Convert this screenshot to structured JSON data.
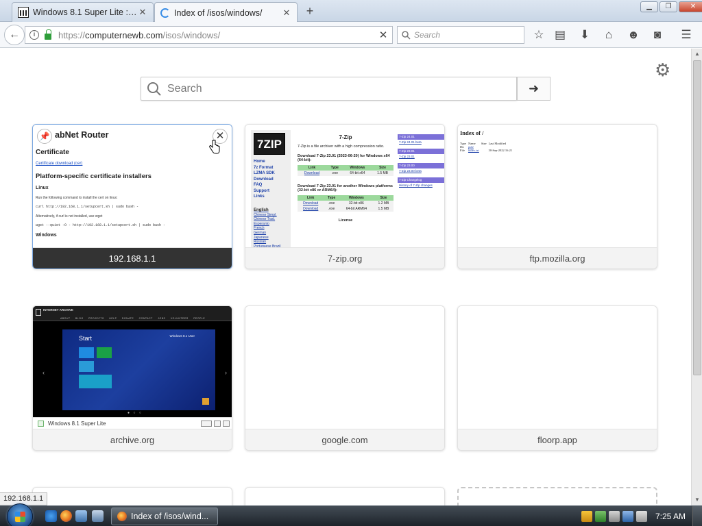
{
  "browser": {
    "tabs": [
      {
        "title": "Windows 8.1 Super Lite : c...",
        "favicon": "archive-icon",
        "active": false
      },
      {
        "title": "Index of /isos/windows/",
        "favicon": "loading-spinner-icon",
        "active": true
      }
    ],
    "url": {
      "host": "computernewb.com",
      "path": "/isos/windows/",
      "scheme": "https://"
    },
    "search_placeholder": "Search"
  },
  "newtab": {
    "search_placeholder": "Search",
    "tiles": [
      {
        "label": "192.168.1.1",
        "hovered": true
      },
      {
        "label": "7-zip.org"
      },
      {
        "label": "ftp.mozilla.org"
      },
      {
        "label": "archive.org"
      },
      {
        "label": "google.com"
      },
      {
        "label": "floorp.app"
      }
    ]
  },
  "router_thumb": {
    "title": "GL.iNet Router",
    "title_visible": "abNet Router",
    "section": "Certificate",
    "link": "Certificate download (cer)",
    "heading": "Platform-specific certificate installers",
    "linux": "Linux",
    "p1": "Run the following command to install the cert on linux:",
    "cmd1": "curl http://192.168.1.1/setupcert.sh | sudo bash -",
    "p2": "Alternatively, if curl is not installed, use wget",
    "cmd2": "wget --quiet -O - http://192.168.1.1/setupcert.sh | sudo bash -",
    "windows": "Windows"
  },
  "zip_thumb": {
    "logo": "7ZIP",
    "nav": [
      "Home",
      "7z Format",
      "LZMA SDK",
      "Download",
      "FAQ",
      "Support",
      "Links"
    ],
    "lang_label": "English",
    "langs": [
      "Chinese Simpl.",
      "Chinese Trad.",
      "Esperanto",
      "French",
      "German",
      "Japanese",
      "Russian",
      "Portuguese Brazil"
    ],
    "title": "7-Zip",
    "intro": "7-Zip is a file archiver with a high compression ratio.",
    "dl1": "Download 7-Zip 23.01 (2023-06-20) for Windows x64 (64-bit):",
    "headers": [
      "Link",
      "Type",
      "Windows",
      "Size"
    ],
    "row1": [
      "Download",
      ".exe",
      "64-bit x64",
      "1.5 MB"
    ],
    "dl2": "Download 7-Zip 23.01 for another Windows platforms (32-bit x86 or ARM64):",
    "row2": [
      "Download",
      ".exe",
      "32-bit x86",
      "1.2 MB"
    ],
    "row3": [
      "Download",
      ".exe",
      "64-bit ARM64",
      "1.5 MB"
    ],
    "license": "License",
    "news": [
      {
        "bar": "7-Zip 24.01",
        "link": "7-Zip 24.01 beta"
      },
      {
        "bar": "7-Zip 23.01",
        "link": "7-Zip 23.01"
      },
      {
        "bar": "7-Zip 23.00",
        "link": "7-Zip 23.00 beta"
      },
      {
        "bar": "7-Zip Changelog",
        "link": "History of 7-Zip changes"
      }
    ]
  },
  "ftp_thumb": {
    "title": "Index of /",
    "headers": [
      "Type",
      "Name",
      "Size",
      "Last Modified"
    ],
    "rows": [
      [
        "Dir",
        "pub/",
        "",
        ""
      ],
      [
        "File",
        "index.txt",
        "",
        "30-Sep-2022 16:21"
      ]
    ]
  },
  "archive_thumb": {
    "site": "INTERNET ARCHIVE",
    "menu": "ABOUT BLOG PROJECTS HELP DONATE CONTACT JOBS VOLUNTEER PEOPLE",
    "start": "Start",
    "user": "Windows 8.1 User",
    "footer_title": "Windows 8.1 Super Lite"
  },
  "status_url": "192.168.1.1",
  "taskbar": {
    "task_label": "Index of /isos/wind...",
    "clock": "7:25 AM"
  }
}
